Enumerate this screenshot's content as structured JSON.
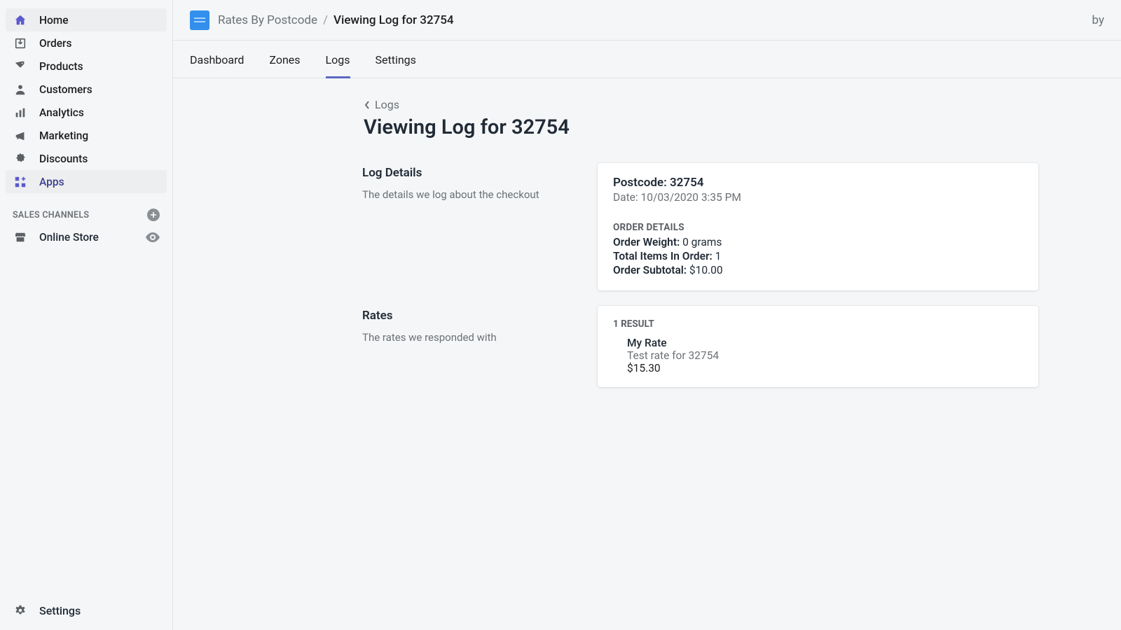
{
  "sidebar": {
    "items": [
      {
        "label": "Home",
        "icon": "home-icon",
        "selected": true
      },
      {
        "label": "Orders",
        "icon": "orders-icon",
        "selected": false
      },
      {
        "label": "Products",
        "icon": "products-icon",
        "selected": false
      },
      {
        "label": "Customers",
        "icon": "customers-icon",
        "selected": false
      },
      {
        "label": "Analytics",
        "icon": "analytics-icon",
        "selected": false
      },
      {
        "label": "Marketing",
        "icon": "marketing-icon",
        "selected": false
      },
      {
        "label": "Discounts",
        "icon": "discounts-icon",
        "selected": false
      },
      {
        "label": "Apps",
        "icon": "apps-icon",
        "selected": false,
        "apps": true
      }
    ],
    "channels_header": "SALES CHANNELS",
    "channels": [
      {
        "label": "Online Store",
        "icon": "store-icon"
      }
    ],
    "settings_label": "Settings"
  },
  "topbar": {
    "app_name": "Rates By Postcode",
    "separator": "/",
    "page": "Viewing Log for 32754",
    "right_text": "by"
  },
  "tabs": [
    {
      "label": "Dashboard",
      "active": false
    },
    {
      "label": "Zones",
      "active": false
    },
    {
      "label": "Logs",
      "active": true
    },
    {
      "label": "Settings",
      "active": false
    }
  ],
  "page": {
    "back_label": "Logs",
    "title": "Viewing Log for 32754",
    "details": {
      "heading": "Log Details",
      "sub": "The details we log about the checkout",
      "postcode_label": "Postcode:",
      "postcode_value": "32754",
      "date_label": "Date:",
      "date_value": "10/03/2020 3:35 PM",
      "order_details_header": "ORDER DETAILS",
      "weight_label": "Order Weight:",
      "weight_value": "0 grams",
      "items_label": "Total Items In Order:",
      "items_value": "1",
      "subtotal_label": "Order Subtotal:",
      "subtotal_value": "$10.00"
    },
    "rates": {
      "heading": "Rates",
      "sub": "The rates we responded with",
      "results_header": "1 RESULT",
      "items": [
        {
          "name": "My Rate",
          "desc": "Test rate for 32754",
          "price": "$15.30"
        }
      ]
    }
  }
}
